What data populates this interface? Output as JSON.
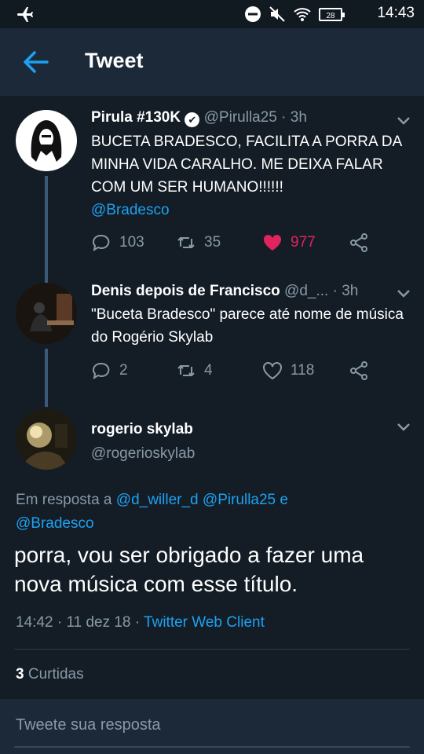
{
  "status": {
    "time": "14:43",
    "battery": "28"
  },
  "header": {
    "title": "Tweet"
  },
  "tweets": [
    {
      "name": "Pirula #130K",
      "verified_glyph": "✔",
      "handle": "@Pirulla25",
      "ago": "3h",
      "text": "BUCETA BRADESCO, FACILITA A PORRA DA MINHA VIDA CARALHO. ME DEIXA FALAR COM UM SER HUMANO!!!!!!",
      "mention": "@Bradesco",
      "replies": "103",
      "retweets": "35",
      "likes": "977"
    },
    {
      "name": "Denis depois de Francisco",
      "handle": "@d_...",
      "ago": "3h",
      "text": "\"Buceta Bradesco\" parece até nome de música do Rogério Skylab",
      "replies": "2",
      "retweets": "4",
      "likes": "118"
    }
  ],
  "main": {
    "name": "rogerio skylab",
    "handle": "@rogerioskylab",
    "reply_prefix": "Em resposta a",
    "reply_mention_1": "@d_willer_d",
    "reply_mention_2": "@Pirulla25",
    "reply_and": "e",
    "reply_mention_3": "@Bradesco",
    "text": "porra, vou ser obrigado a fazer uma nova música com esse título.",
    "time": "14:42",
    "date": "11 dez 18",
    "client": "Twitter Web Client",
    "likes_count": "3",
    "likes_label": "Curtidas"
  },
  "reply_bar": {
    "placeholder": "Tweete sua resposta"
  },
  "colors": {
    "accent": "#1da1f2",
    "like": "#e0245e",
    "background": "#141d26",
    "bar": "#1c2938"
  }
}
